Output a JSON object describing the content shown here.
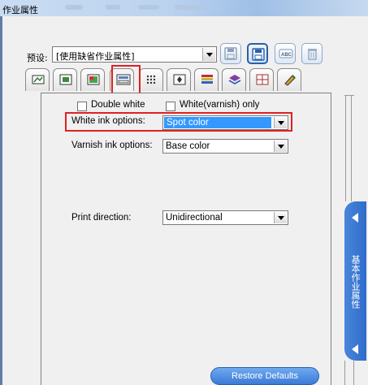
{
  "window": {
    "title": "作业属性"
  },
  "preset": {
    "label": "预设:",
    "value": "[使用缺省作业属性]"
  },
  "toolbar": {
    "buttons": [
      "save-icon",
      "save-as-icon",
      "rename-icon",
      "delete-icon"
    ],
    "rename_text": "ABC"
  },
  "tabs": {
    "icons": [
      "general-icon",
      "media-icon",
      "color-icon",
      "print-mode-icon",
      "halftone-icon",
      "layout-icon",
      "color-bars-icon",
      "finishing-icon",
      "grid-icon",
      "pen-icon"
    ],
    "selected_index": 3
  },
  "options": {
    "double_white": {
      "label": "Double white",
      "checked": false
    },
    "white_varnish_only": {
      "label": "White(varnish) only",
      "checked": false
    },
    "white_ink": {
      "label": "White ink options:",
      "value": "Spot color"
    },
    "varnish_ink": {
      "label": "Varnish ink options:",
      "value": "Base color"
    },
    "print_direction": {
      "label": "Print direction:",
      "value": "Unidirectional"
    }
  },
  "restore_button": {
    "label": "Restore Defaults"
  },
  "side_panel": {
    "label": "基本作业属性"
  },
  "colors": {
    "accent": "#3399ff",
    "highlight_box": "#e02020",
    "side_tab": "#3a78d4"
  }
}
